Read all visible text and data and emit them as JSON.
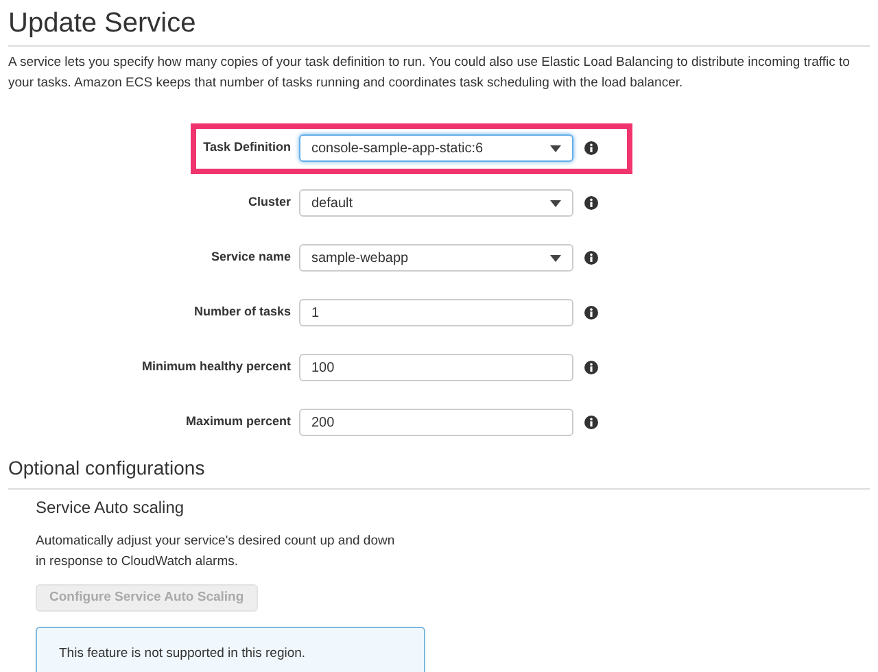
{
  "title": "Update Service",
  "description": "A service lets you specify how many copies of your task definition to run. You could also use Elastic Load Balancing to distribute incoming traffic to your tasks. Amazon ECS keeps that number of tasks running and coordinates task scheduling with the load balancer.",
  "fields": [
    {
      "label": "Task Definition",
      "kind": "select",
      "value": "console-sample-app-static:6",
      "highlighted": true,
      "focused": true
    },
    {
      "label": "Cluster",
      "kind": "select",
      "value": "default",
      "highlighted": false,
      "focused": false
    },
    {
      "label": "Service name",
      "kind": "select",
      "value": "sample-webapp",
      "highlighted": false,
      "focused": false
    },
    {
      "label": "Number of tasks",
      "kind": "input",
      "value": "1",
      "highlighted": false,
      "focused": false
    },
    {
      "label": "Minimum healthy percent",
      "kind": "input",
      "value": "100",
      "highlighted": false,
      "focused": false
    },
    {
      "label": "Maximum percent",
      "kind": "input",
      "value": "200",
      "highlighted": false,
      "focused": false
    }
  ],
  "optional": {
    "heading": "Optional configurations",
    "subheading": "Service Auto scaling",
    "text": "Automatically adjust your service's desired count up and down in response to CloudWatch alarms.",
    "button": {
      "label": "Configure Service Auto Scaling",
      "disabled": true
    },
    "notice": "This feature is not supported in this region."
  }
}
